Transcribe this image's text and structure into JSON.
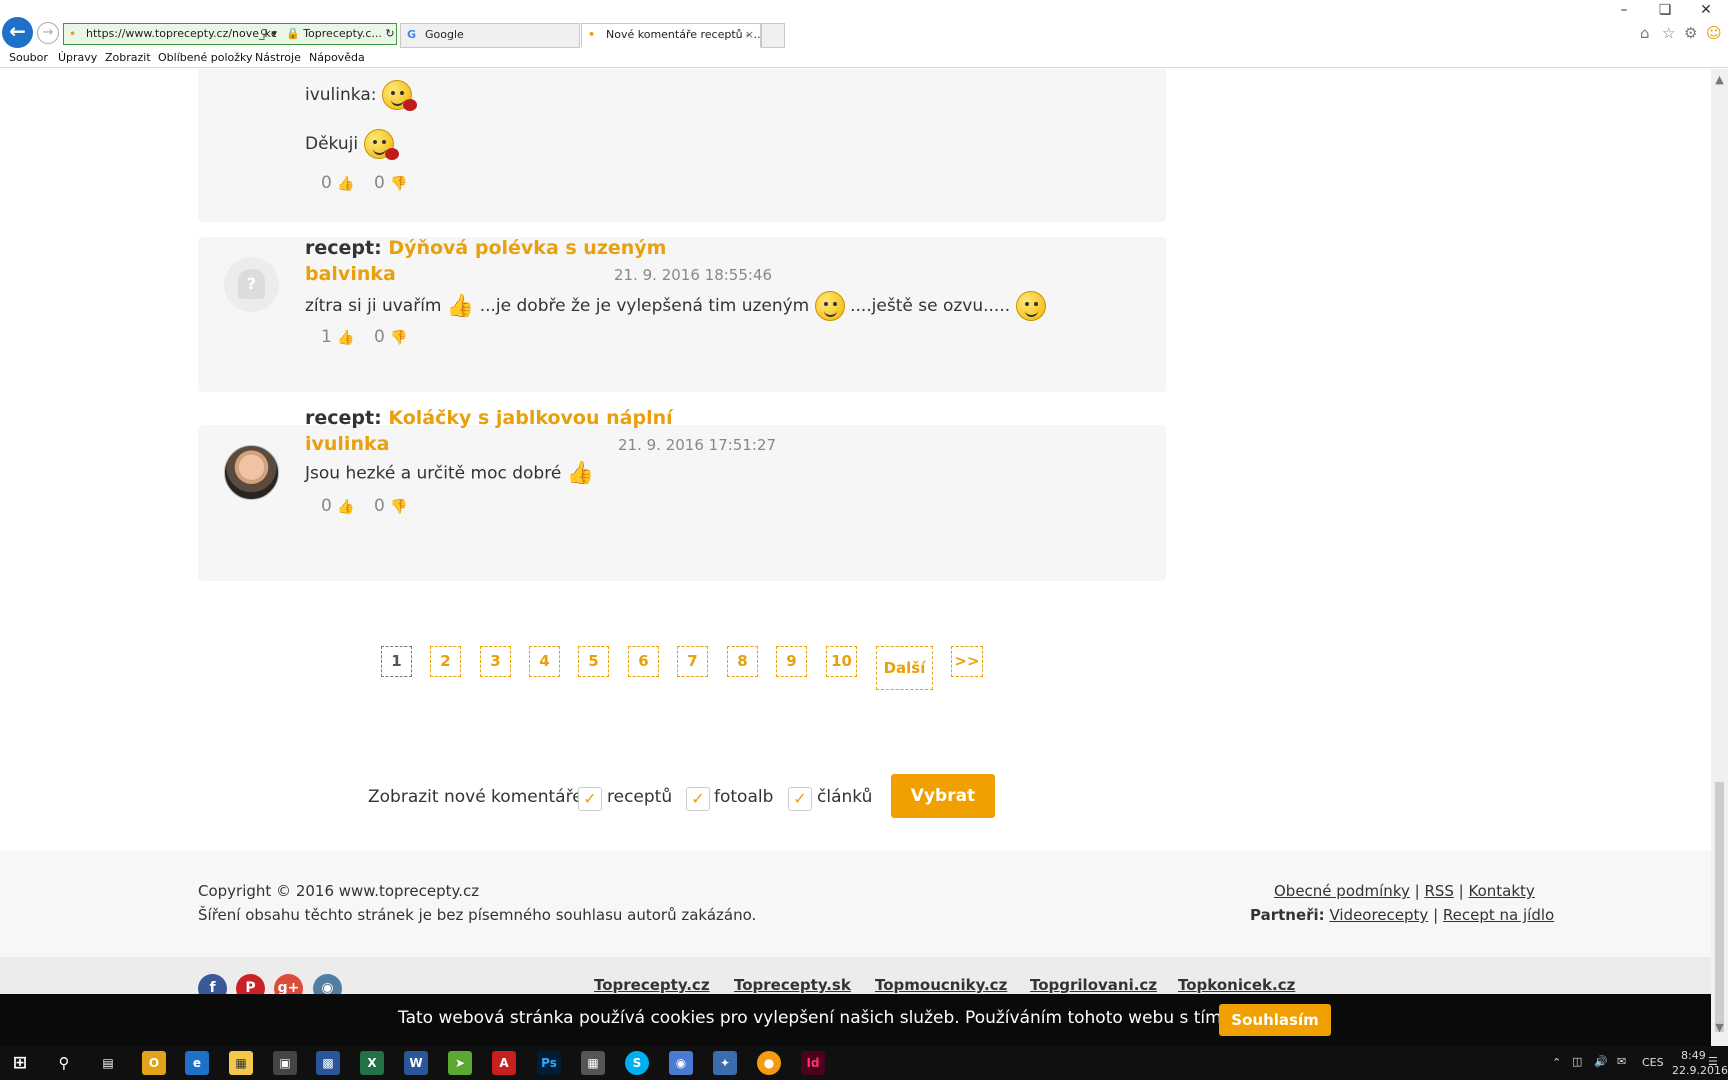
{
  "browser": {
    "url": "https://www.toprecepty.cz/nove_kc",
    "site_label": "Toprecepty.c...",
    "tabs": [
      {
        "label": "Google"
      },
      {
        "label": "Nové komentáře receptů - ..."
      }
    ],
    "menu": [
      "Soubor",
      "Úpravy",
      "Zobrazit",
      "Oblíbené položky",
      "Nástroje",
      "Nápověda"
    ]
  },
  "comments": [
    {
      "lines": [
        "ivulinka:",
        "Děkuji"
      ],
      "likes": "0",
      "dislikes": "0"
    },
    {
      "label": "recept:",
      "recipe": "Dýňová polévka s uzeným",
      "user": "balvinka",
      "date": "21. 9. 2016 18:55:46",
      "text_parts": [
        "zítra si ji uvařím",
        "...je dobře že je vylepšená tim uzeným",
        "....ještě se ozvu....."
      ],
      "likes": "1",
      "dislikes": "0"
    },
    {
      "label": "recept:",
      "recipe": "Koláčky s jablkovou náplní",
      "user": "ivulinka",
      "date": "21. 9. 2016 17:51:27",
      "text": "Jsou hezké a určitě moc dobré",
      "likes": "0",
      "dislikes": "0"
    }
  ],
  "pagination": {
    "pages": [
      "1",
      "2",
      "3",
      "4",
      "5",
      "6",
      "7",
      "8",
      "9",
      "10"
    ],
    "current": "1",
    "next": "Další",
    "last": ">>"
  },
  "filter": {
    "label": "Zobrazit nové komentáře",
    "options": [
      "receptů",
      "fotoalb",
      "článků"
    ],
    "button": "Vybrat"
  },
  "footer": {
    "copyright": "Copyright © 2016 www.toprecepty.cz",
    "notice": "Šíření obsahu těchto stránek je bez písemného souhlasu autorů zakázáno.",
    "links": [
      "Obecné podmínky",
      "RSS",
      "Kontakty"
    ],
    "partners_label": "Partneři:",
    "partners": [
      "Videorecepty",
      "Recept na jídlo"
    ],
    "network": [
      "Toprecepty.cz",
      "Toprecepty.sk",
      "Topmoucniky.cz",
      "Topgrilovani.cz",
      "Topkonicek.cz"
    ]
  },
  "cookie": {
    "text": "Tato webová stránka používá cookies pro vylepšení našich služeb. Používáním tohoto webu s tím souhlasíte.",
    "button": "Souhlasím"
  },
  "taskbar": {
    "lang": "CES",
    "time": "8:49",
    "date": "22.9.2016"
  },
  "colors": {
    "accent": "#e8a00e",
    "card_bg": "#f6f6f6",
    "cookie_bg": "#0a0a0a"
  }
}
